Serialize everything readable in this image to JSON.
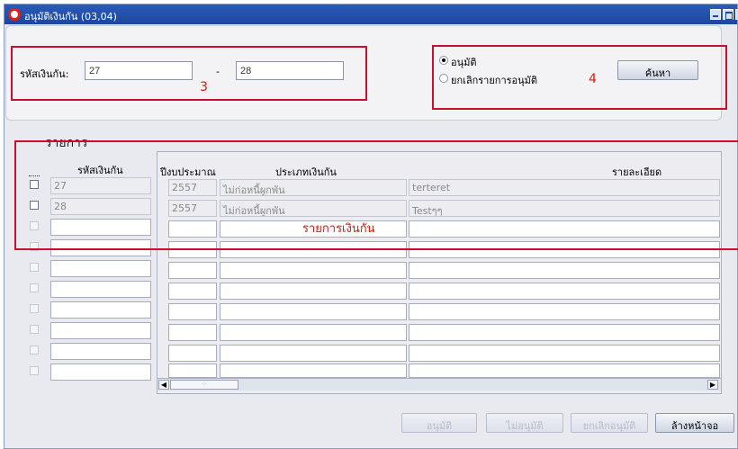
{
  "window": {
    "title": "อนุมัติเงินกัน (03,04)"
  },
  "search": {
    "code_label": "รหัสเงินกัน:",
    "code_from": "27",
    "separator": "-",
    "code_to": "28",
    "annotation_3": "3",
    "radio_approve": "อนุมัติ",
    "radio_cancel": "ยกเลิกรายการอนุมัติ",
    "annotation_4": "4",
    "search_button": "ค้นหา"
  },
  "list": {
    "section_title": "รายการ",
    "col_code": "รหัสเงินกัน",
    "col_year": "ปีงบประมาณ",
    "col_type": "ประเภทเงินกัน",
    "col_detail": "รายละเอียด",
    "annotation_rows": "รายการเงินกัน",
    "rows": [
      {
        "code": "27",
        "year": "2557",
        "type": "ไม่ก่อหนี้ผูกพัน",
        "detail": "terteret"
      },
      {
        "code": "28",
        "year": "2557",
        "type": "ไม่ก่อหนี้ผูกพัน",
        "detail": "Testๆๆ"
      },
      {
        "code": "",
        "year": "",
        "type": "",
        "detail": ""
      },
      {
        "code": "",
        "year": "",
        "type": "",
        "detail": ""
      },
      {
        "code": "",
        "year": "",
        "type": "",
        "detail": ""
      },
      {
        "code": "",
        "year": "",
        "type": "",
        "detail": ""
      },
      {
        "code": "",
        "year": "",
        "type": "",
        "detail": ""
      },
      {
        "code": "",
        "year": "",
        "type": "",
        "detail": ""
      },
      {
        "code": "",
        "year": "",
        "type": "",
        "detail": ""
      },
      {
        "code": "",
        "year": "",
        "type": "",
        "detail": ""
      }
    ]
  },
  "footer": {
    "approve_button": "อนุมัติ",
    "not_approve_button": "ไม่อนุมัติ",
    "cancel_approve_button": "ยกเลิกอนุมัติ",
    "clear_button": "ล้างหน้าจอ"
  },
  "colors": {
    "title_bar": "#1c47a0",
    "annotation_red": "#d41a10"
  }
}
